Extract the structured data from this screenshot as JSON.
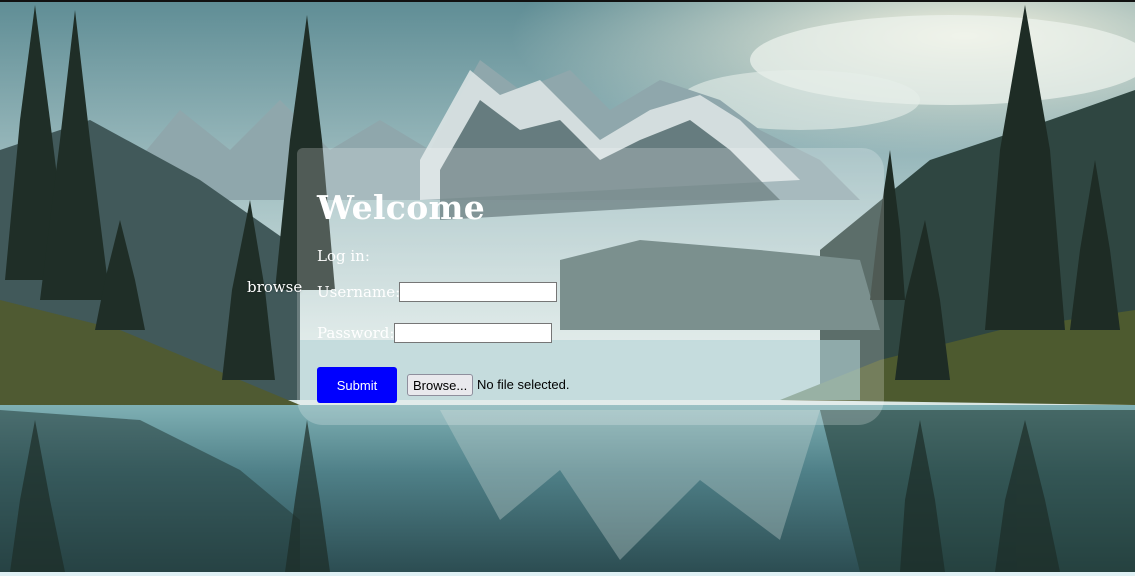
{
  "side_link": {
    "label": "browse"
  },
  "form": {
    "title": "Welcome",
    "login_label": "Log in:",
    "username_label": "Username:",
    "username_value": "",
    "password_label": "Password:",
    "password_value": "",
    "submit_label": "Submit",
    "file_button_label": "Browse...",
    "file_status": "No file selected."
  },
  "colors": {
    "submit_bg": "#0000ff",
    "text": "#ffffff",
    "panel_overlay": "rgba(255,255,255,0.22)"
  },
  "background": {
    "scene": "mountain-lake-landscape"
  }
}
